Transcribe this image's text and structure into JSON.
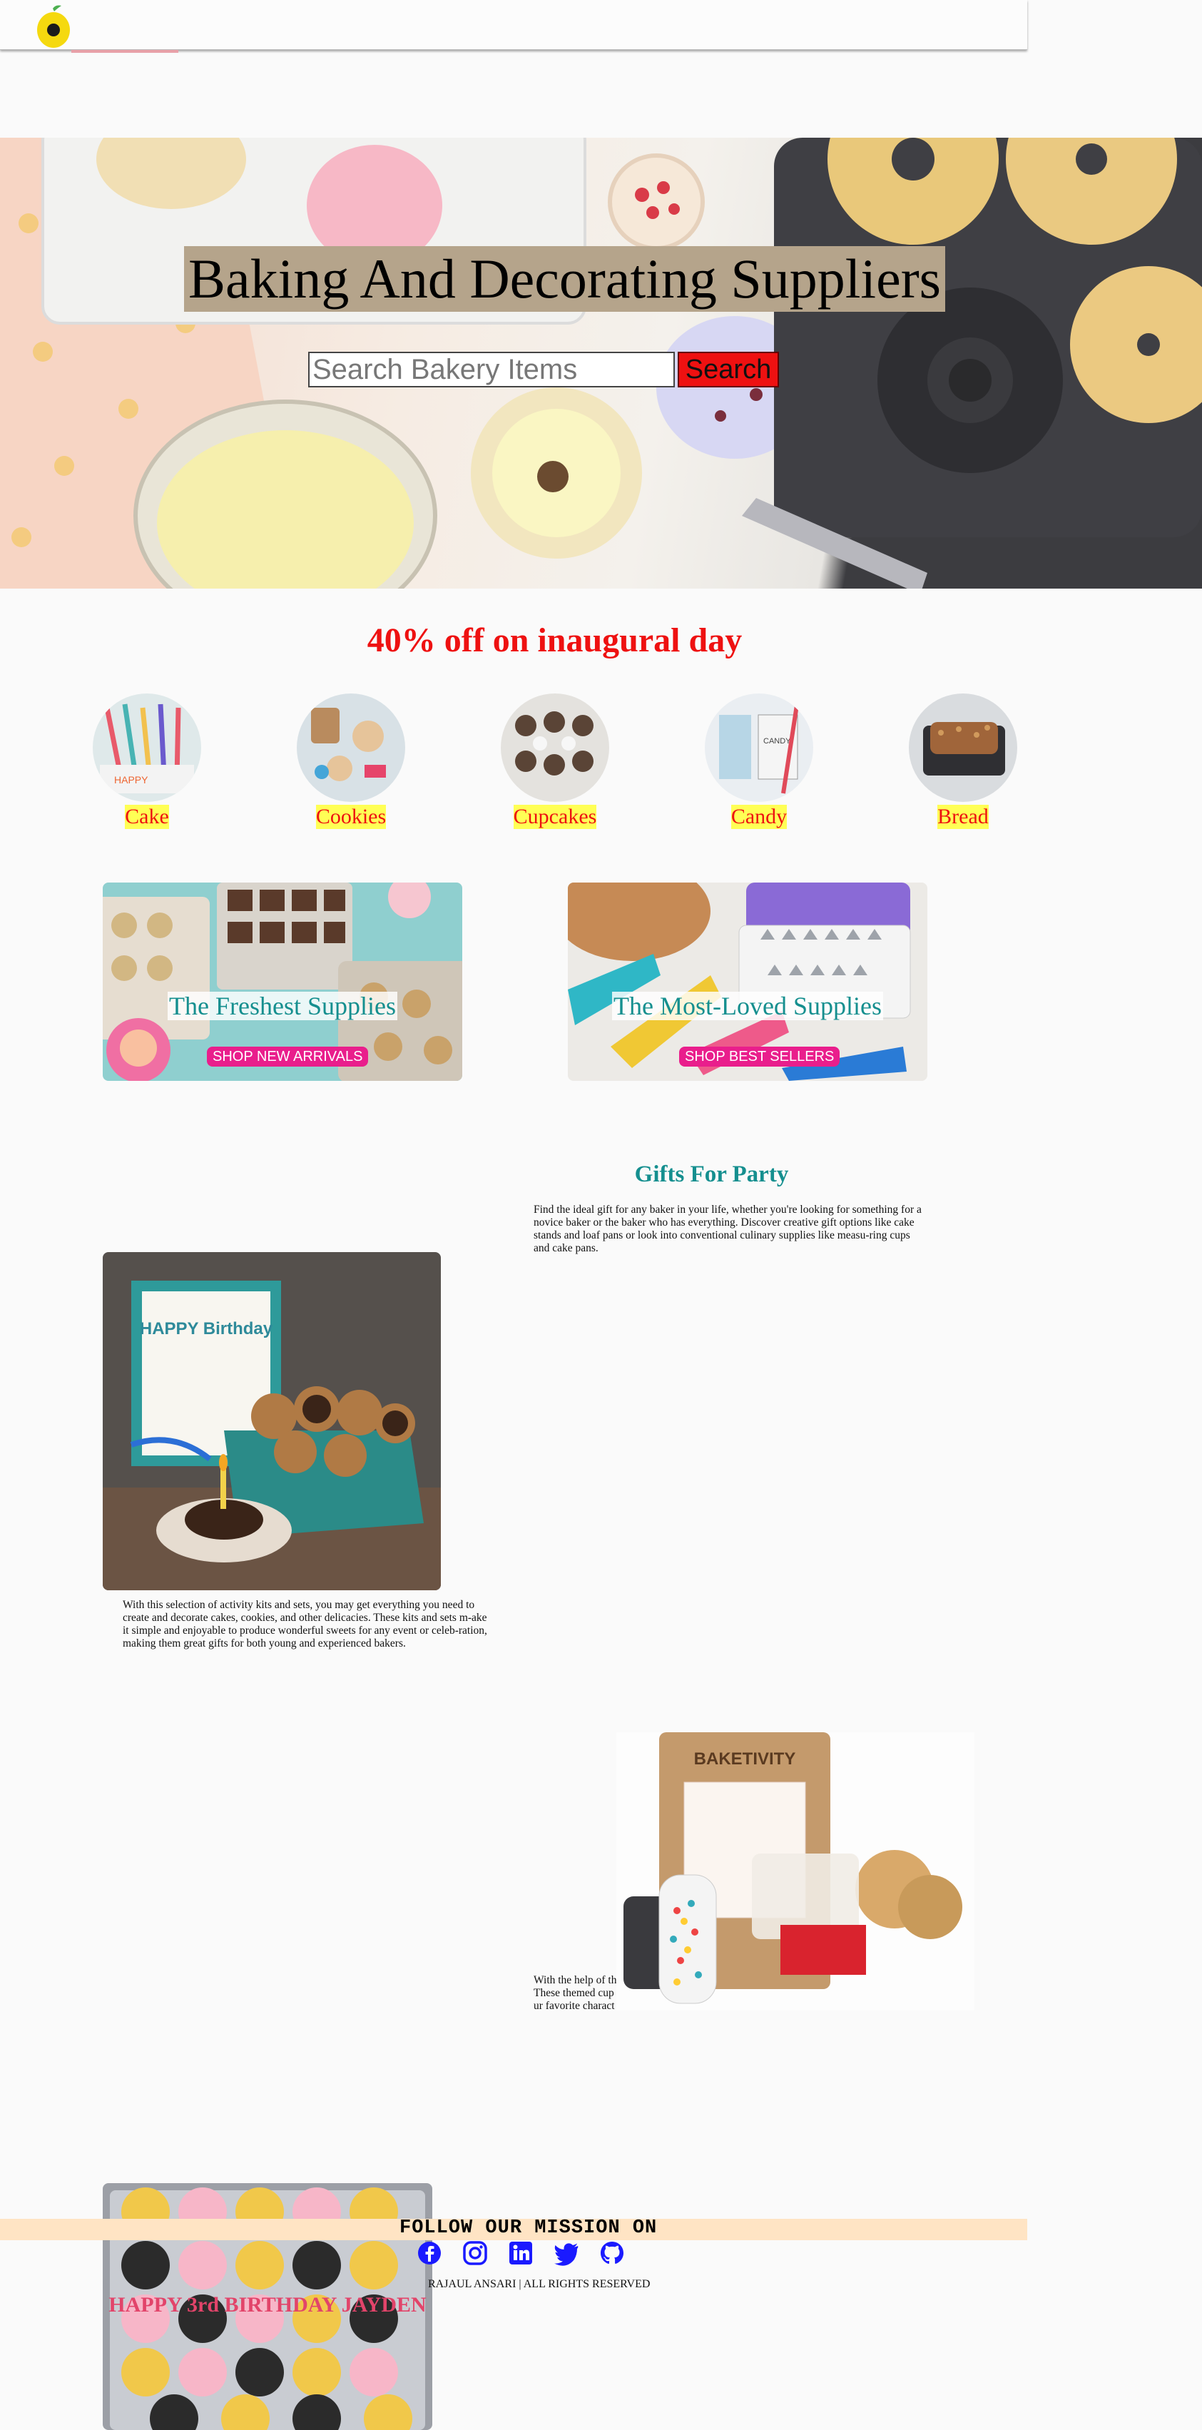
{
  "header": {
    "logo": "lemon-logo"
  },
  "hero": {
    "title": "Baking And Decorating Suppliers",
    "search_placeholder": "Search Bakery Items",
    "search_button": "Search"
  },
  "offer": {
    "text": "40% off on inaugural day"
  },
  "categories": [
    {
      "label": "Cake"
    },
    {
      "label": "Cookies"
    },
    {
      "label": "Cupcakes"
    },
    {
      "label": "Candy"
    },
    {
      "label": "Bread"
    }
  ],
  "promos": [
    {
      "title": "The Freshest Supplies",
      "button": "SHOP NEW ARRIVALS"
    },
    {
      "title": "The Most-Loved Supplies",
      "button": "SHOP BEST SELLERS"
    }
  ],
  "gifts": {
    "title": "Gifts For Party",
    "para1": "Find the ideal gift for any baker in your life, whether you're looking for something for a novice baker or the baker who has everything. Discover creative gift options like cake stands and loaf pans or look into conventional culinary supplies like measu-ring cups and cake pans.",
    "para2": "With this selection of activity kits and sets, you may get everything you need to create and decorate cakes, cookies, and other delicacies. These kits and sets m-ake it simple and enjoyable to produce wonderful sweets for any event or celeb-ration, making them great gifts for both young and experienced bakers.",
    "para3_line1": "With the help of th",
    "para3_line2": "These themed cup",
    "para3_line3": "ur favorite charact",
    "box_text": "HAPPY Birthday",
    "kit_brand": "BAKETIVITY",
    "cake_text": "HAPPY 3rd BIRTHDAY JAYDEN"
  },
  "footer": {
    "mission": "FOLLOW OUR MISSION ON",
    "copyright": "RAJAUL ANSARI | ALL RIGHTS RESERVED",
    "icons": [
      "facebook-icon",
      "instagram-icon",
      "linkedin-icon",
      "twitter-icon",
      "github-icon"
    ],
    "icon_color": "#1a1aff"
  },
  "colors": {
    "accent_red": "#ee1111",
    "teal": "#158f8f",
    "highlight_yellow": "#ffff55",
    "pink_button": "#e91e8c",
    "footer_band": "#ffe4c4"
  }
}
